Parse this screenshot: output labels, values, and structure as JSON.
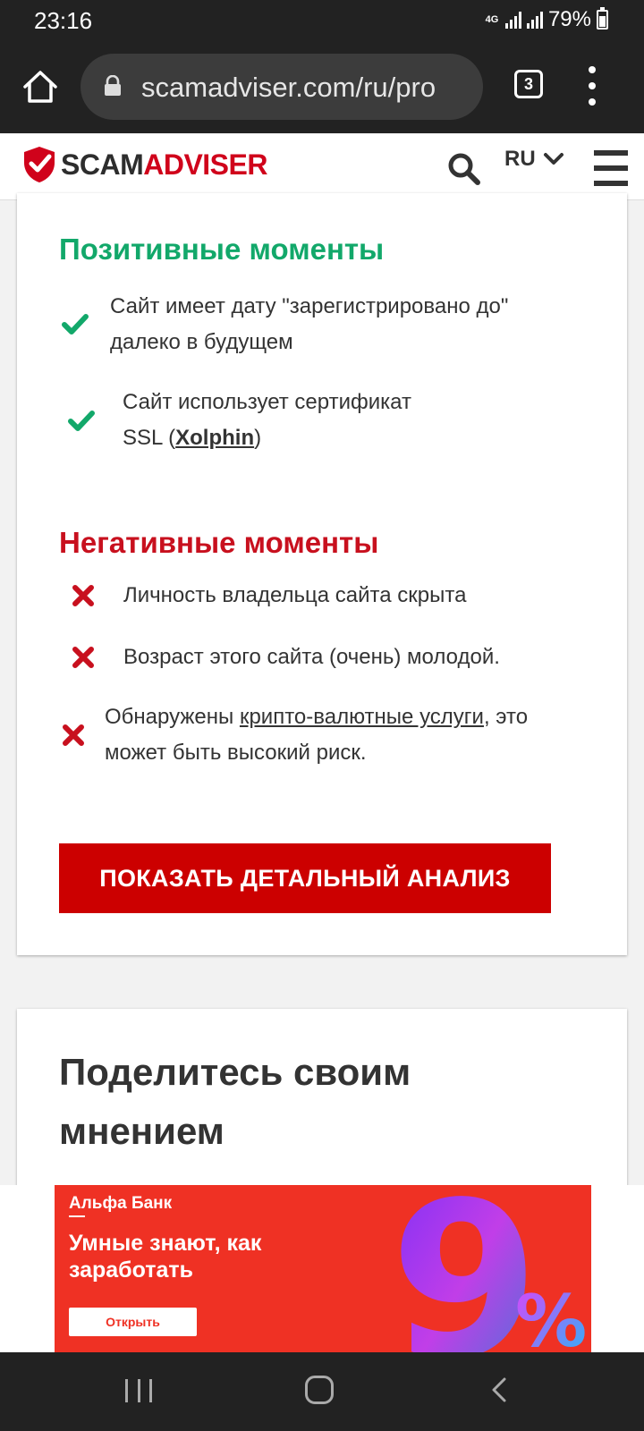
{
  "status_bar": {
    "time": "23:16",
    "network": "4G",
    "battery": "79%",
    "battery_level": 0.79
  },
  "browser": {
    "url": "scamadviser.com/ru/pro",
    "tab_count": "3"
  },
  "header": {
    "logo_scam": "SCAM",
    "logo_adviser": "ADVISER",
    "language": "RU"
  },
  "positive": {
    "title": "Позитивные моменты",
    "items": [
      {
        "line1": "Сайт имеет дату \"зарегистрировано до\"",
        "line2": "далеко в будущем"
      },
      {
        "line1": "Сайт использует сертификат",
        "line2_prefix": "SSL (",
        "line2_link": "Xolphin",
        "line2_suffix": ")"
      }
    ]
  },
  "negative": {
    "title": "Негативные моменты",
    "items": [
      {
        "text": "Личность владельца сайта скрыта"
      },
      {
        "text": "Возраст этого сайта (очень) молодой."
      },
      {
        "line1_prefix": "Обнаружены ",
        "line1_link": "крипто-валютные услуги",
        "line1_suffix": ", это",
        "line2": "может быть высокий риск."
      }
    ]
  },
  "cta_label": "ПОКАЗАТЬ ДЕТАЛЬНЫЙ АНАЛИЗ",
  "share": {
    "title": "Поделитесь своим мнением"
  },
  "ad": {
    "brand": "Альфа Банк",
    "headline": "Умные знают, как заработать",
    "button": "Открыть",
    "graphic_text": "9%"
  },
  "colors": {
    "positive": "#12a86a",
    "negative": "#c8101e",
    "cta": "#cc0000",
    "ad_bg": "#ef3124",
    "brand_red": "#d0021b"
  }
}
